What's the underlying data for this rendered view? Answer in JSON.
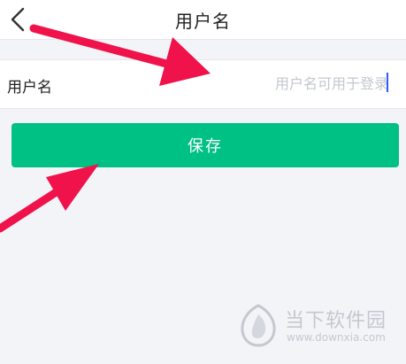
{
  "header": {
    "title": "用户名",
    "back_icon": "chevron-left-icon"
  },
  "form": {
    "label": "用户名",
    "value": "",
    "placeholder": "用户名可用于登录"
  },
  "actions": {
    "save_label": "保存"
  },
  "annotations": {
    "arrow_color": "#f0124a"
  },
  "watermark": {
    "site_name": "当下软件园",
    "url": "www.downxia.com"
  },
  "colors": {
    "primary": "#00c184",
    "background": "#f3f4f8",
    "placeholder": "#c3c7cf",
    "caret": "#2c5cff"
  }
}
